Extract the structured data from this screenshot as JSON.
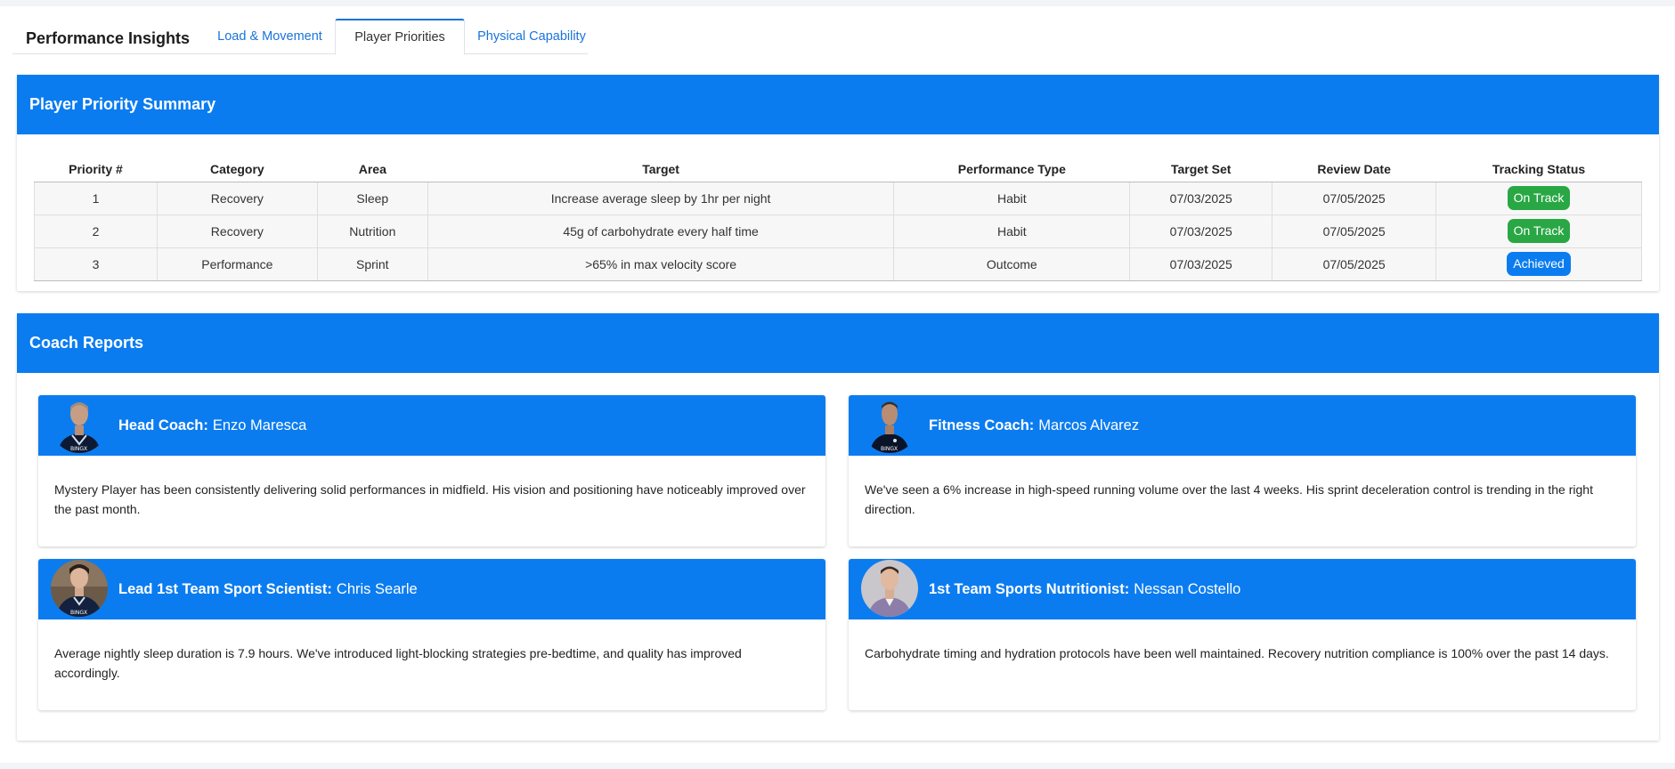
{
  "header": {
    "title": "Performance Insights",
    "tabs": [
      {
        "label": "Load & Movement",
        "active": false
      },
      {
        "label": "Player Priorities",
        "active": true
      },
      {
        "label": "Physical Capability",
        "active": false
      }
    ]
  },
  "priority_summary": {
    "title": "Player Priority Summary",
    "columns": [
      "Priority #",
      "Category",
      "Area",
      "Target",
      "Performance Type",
      "Target Set",
      "Review Date",
      "Tracking Status"
    ],
    "rows": [
      {
        "num": "1",
        "category": "Recovery",
        "area": "Sleep",
        "target": "Increase average sleep by 1hr per night",
        "type": "Habit",
        "target_set": "07/03/2025",
        "review": "07/05/2025",
        "status": "On Track"
      },
      {
        "num": "2",
        "category": "Recovery",
        "area": "Nutrition",
        "target": "45g of carbohydrate every half time",
        "type": "Habit",
        "target_set": "07/03/2025",
        "review": "07/05/2025",
        "status": "On Track"
      },
      {
        "num": "3",
        "category": "Performance",
        "area": "Sprint",
        "target": ">65% in max velocity score",
        "type": "Outcome",
        "target_set": "07/03/2025",
        "review": "07/05/2025",
        "status": "Achieved"
      }
    ],
    "status_colors": {
      "On Track": "#29a745",
      "Achieved": "#0b7cf0"
    }
  },
  "coach_reports": {
    "title": "Coach Reports",
    "cards": [
      {
        "role": "Head Coach:",
        "name": "Enzo Maresca",
        "text": "Mystery Player has been consistently delivering solid performances in midfield. His vision and positioning have noticeably improved over the past month."
      },
      {
        "role": "Fitness Coach:",
        "name": "Marcos Alvarez",
        "text": "We've seen a 6% increase in high-speed running volume over the last 4 weeks. His sprint deceleration control is trending in the right direction."
      },
      {
        "role": "Lead 1st Team Sport Scientist:",
        "name": "Chris Searle",
        "text": "Average nightly sleep duration is 7.9 hours. We've introduced light-blocking strategies pre-bedtime, and quality has improved accordingly."
      },
      {
        "role": "1st Team Sports Nutritionist:",
        "name": "Nessan Costello",
        "text": "Carbohydrate timing and hydration protocols have been well maintained. Recovery nutrition compliance is 100% over the past 14 days."
      }
    ]
  },
  "colors": {
    "accent": "#0b7cf0",
    "success": "#29a745"
  }
}
